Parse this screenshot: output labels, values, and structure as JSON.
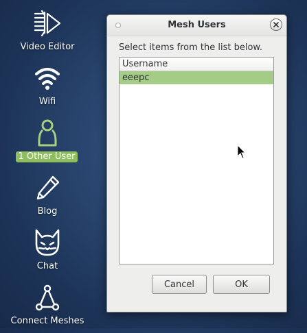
{
  "desktop": {
    "icons": [
      {
        "label": "Video Editor",
        "icon": "video-editor-icon"
      },
      {
        "label": "Wifi",
        "icon": "wifi-icon"
      },
      {
        "label": "1 Other User",
        "icon": "user-icon",
        "selected": true
      },
      {
        "label": "Blog",
        "icon": "pencil-icon"
      },
      {
        "label": "Chat",
        "icon": "cat-icon"
      },
      {
        "label": "Connect Meshes",
        "icon": "mesh-network-icon"
      }
    ],
    "selected_label_color": "#8fbe5e"
  },
  "dialog": {
    "title": "Mesh Users",
    "prompt": "Select items from the list below.",
    "list": {
      "header": "Username",
      "rows": [
        "eeepc"
      ],
      "selected_row_color": "#a4cc87"
    },
    "buttons": {
      "cancel_label": "Cancel",
      "ok_label": "OK"
    }
  }
}
